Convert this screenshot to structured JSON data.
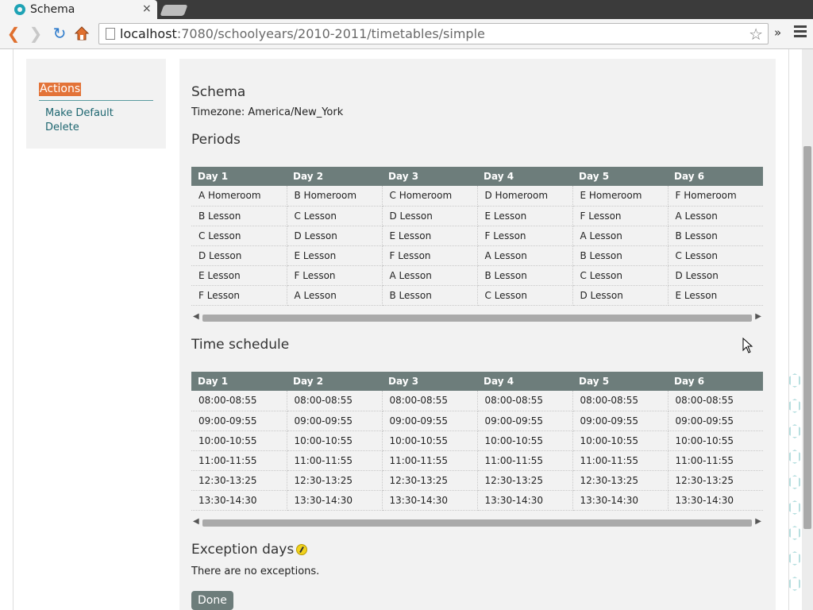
{
  "browser": {
    "tab_title": "Schema",
    "tab_close": "×",
    "url_host": "localhost",
    "url_path": ":7080/schoolyears/2010-2011/timetables/simple",
    "extensions_chevron": "»"
  },
  "sidebar": {
    "heading": "Actions",
    "links": [
      "Make Default",
      "Delete"
    ]
  },
  "main": {
    "title": "Schema",
    "timezone": "Timezone: America/New_York",
    "periods_heading": "Periods",
    "time_heading": "Time schedule",
    "exceptions_heading": "Exception days",
    "exceptions_text": "There are no exceptions.",
    "done_label": "Done"
  },
  "periods": {
    "headers": [
      "Day 1",
      "Day 2",
      "Day 3",
      "Day 4",
      "Day 5",
      "Day 6"
    ],
    "rows": [
      [
        "A Homeroom",
        "B Homeroom",
        "C Homeroom",
        "D Homeroom",
        "E Homeroom",
        "F Homeroom"
      ],
      [
        "B Lesson",
        "C Lesson",
        "D Lesson",
        "E Lesson",
        "F Lesson",
        "A Lesson"
      ],
      [
        "C Lesson",
        "D Lesson",
        "E Lesson",
        "F Lesson",
        "A Lesson",
        "B Lesson"
      ],
      [
        "D Lesson",
        "E Lesson",
        "F Lesson",
        "A Lesson",
        "B Lesson",
        "C Lesson"
      ],
      [
        "E Lesson",
        "F Lesson",
        "A Lesson",
        "B Lesson",
        "C Lesson",
        "D Lesson"
      ],
      [
        "F Lesson",
        "A Lesson",
        "B Lesson",
        "C Lesson",
        "D Lesson",
        "E Lesson"
      ]
    ]
  },
  "times": {
    "headers": [
      "Day 1",
      "Day 2",
      "Day 3",
      "Day 4",
      "Day 5",
      "Day 6"
    ],
    "rows": [
      [
        "08:00-08:55",
        "08:00-08:55",
        "08:00-08:55",
        "08:00-08:55",
        "08:00-08:55",
        "08:00-08:55"
      ],
      [
        "09:00-09:55",
        "09:00-09:55",
        "09:00-09:55",
        "09:00-09:55",
        "09:00-09:55",
        "09:00-09:55"
      ],
      [
        "10:00-10:55",
        "10:00-10:55",
        "10:00-10:55",
        "10:00-10:55",
        "10:00-10:55",
        "10:00-10:55"
      ],
      [
        "11:00-11:55",
        "11:00-11:55",
        "11:00-11:55",
        "11:00-11:55",
        "11:00-11:55",
        "11:00-11:55"
      ],
      [
        "12:30-13:25",
        "12:30-13:25",
        "12:30-13:25",
        "12:30-13:25",
        "12:30-13:25",
        "12:30-13:25"
      ],
      [
        "13:30-14:30",
        "13:30-14:30",
        "13:30-14:30",
        "13:30-14:30",
        "13:30-14:30",
        "13:30-14:30"
      ]
    ]
  }
}
